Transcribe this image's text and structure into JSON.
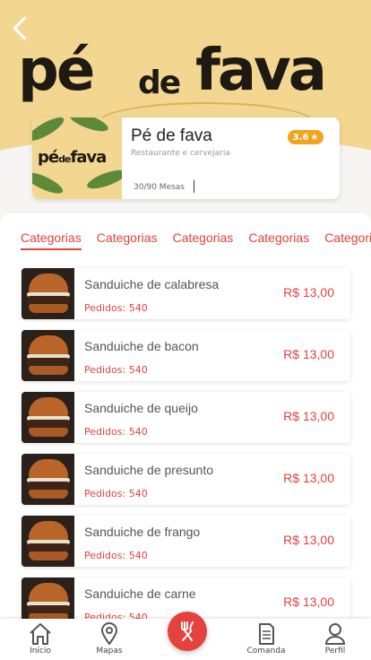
{
  "colors": {
    "accent": "#e5413e",
    "rating": "#f0a51d",
    "hero": "#f3d68f"
  },
  "hero": {
    "brand_part1": "pé",
    "brand_part2": "de",
    "brand_part3": "fava"
  },
  "restaurant": {
    "logo_part1": "pé",
    "logo_part2": "de",
    "logo_part3": "fava",
    "name": "Pé de fava",
    "subtitle": "Restaurante e cervejaria",
    "tables": "30/90 Mesas",
    "rating": "3.6"
  },
  "tabs": [
    "Categorias",
    "Categorias",
    "Categorias",
    "Categorias",
    "Categorias"
  ],
  "items": [
    {
      "name": "Sanduiche de calabresa",
      "orders": "Pedidos: 540",
      "price": "R$ 13,00"
    },
    {
      "name": "Sanduiche de bacon",
      "orders": "Pedidos: 540",
      "price": "R$ 13,00"
    },
    {
      "name": "Sanduiche de queijo",
      "orders": "Pedidos: 540",
      "price": "R$ 13,00"
    },
    {
      "name": "Sanduiche de presunto",
      "orders": "Pedidos: 540",
      "price": "R$ 13,00"
    },
    {
      "name": "Sanduiche de frango",
      "orders": "Pedidos: 540",
      "price": "R$ 13,00"
    },
    {
      "name": "Sanduiche de carne",
      "orders": "Pedidos: 540",
      "price": "R$ 13,00"
    }
  ],
  "nav": {
    "home": "Início",
    "maps": "Mapas",
    "order": "Comanda",
    "profile": "Perfil",
    "icons": [
      "home-icon",
      "map-pin-icon",
      "cutlery-icon",
      "document-icon",
      "user-icon"
    ]
  }
}
